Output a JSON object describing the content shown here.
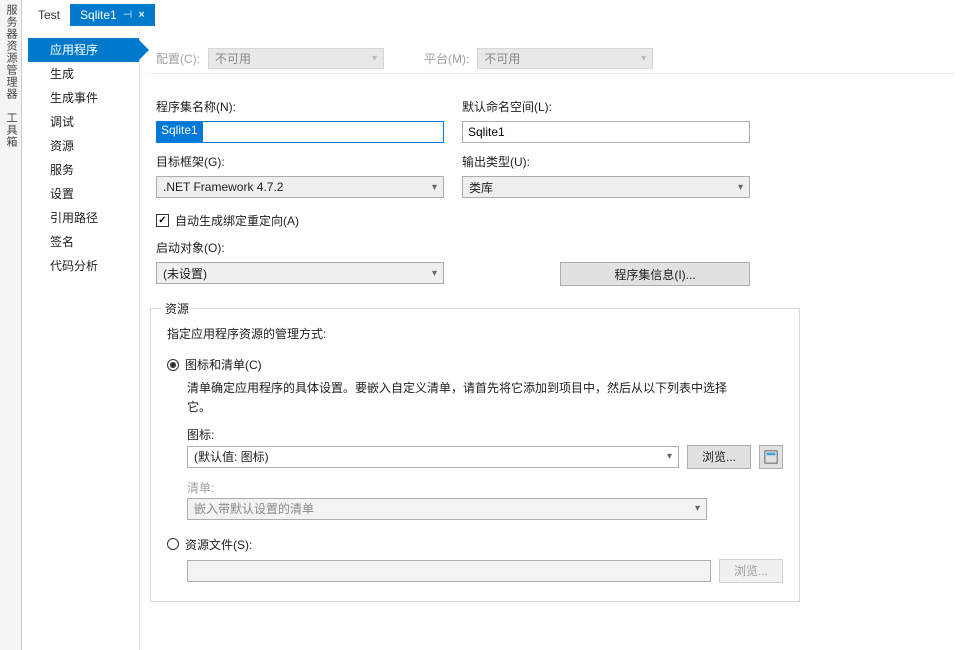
{
  "sidebars": {
    "server_explorer": "服务器资源管理器",
    "toolbox": "工具箱"
  },
  "tabs": {
    "test": "Test",
    "sqlite1": "Sqlite1"
  },
  "nav": {
    "app": "应用程序",
    "build": "生成",
    "build_events": "生成事件",
    "debug": "调试",
    "resources": "资源",
    "services": "服务",
    "settings": "设置",
    "ref_paths": "引用路径",
    "signing": "签名",
    "code_analysis": "代码分析"
  },
  "top": {
    "config_label": "配置(C):",
    "config_value": "不可用",
    "platform_label": "平台(M):",
    "platform_value": "不可用"
  },
  "form": {
    "assembly_name_label": "程序集名称(N):",
    "assembly_name": "Sqlite1",
    "default_ns_label": "默认命名空间(L):",
    "default_ns": "Sqlite1",
    "target_fw_label": "目标框架(G):",
    "target_fw": ".NET Framework 4.7.2",
    "output_type_label": "输出类型(U):",
    "output_type": "类库",
    "auto_redirect": "自动生成绑定重定向(A)",
    "startup_label": "启动对象(O):",
    "startup": "(未设置)",
    "assembly_info_btn": "程序集信息(I)..."
  },
  "res": {
    "legend": "资源",
    "hint_top": "指定应用程序资源的管理方式:",
    "icon_manifest_radio": "图标和清单(C)",
    "manifest_hint": "清单确定应用程序的具体设置。要嵌入自定义清单，请首先将它添加到项目中，然后从以下列表中选择它。",
    "icon_label": "图标:",
    "icon_value": "(默认值: 图标)",
    "browse_btn": "浏览...",
    "manifest_label": "清单:",
    "manifest_value": "嵌入带默认设置的清单",
    "resfile_radio": "资源文件(S):"
  }
}
